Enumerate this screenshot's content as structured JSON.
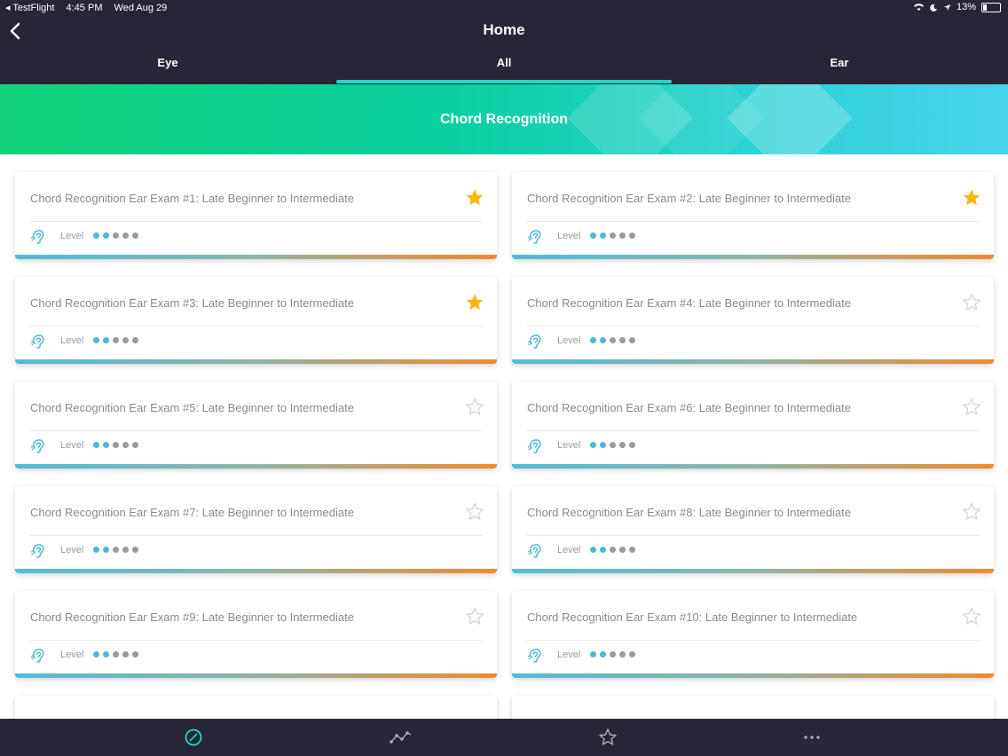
{
  "status_bar": {
    "carrier": "◂ TestFlight",
    "time": "4:45 PM",
    "date": "Wed Aug 29",
    "battery": "13%"
  },
  "header": {
    "title": "Home"
  },
  "tabs": [
    {
      "label": "Eye"
    },
    {
      "label": "All"
    },
    {
      "label": "Ear"
    }
  ],
  "banner": {
    "title": "Chord Recognition"
  },
  "cards": [
    {
      "title": "Chord Recognition Ear Exam #1: Late Beginner to Intermediate",
      "favorite": true,
      "level_label": "Level",
      "level": 2
    },
    {
      "title": "Chord Recognition Ear Exam #2: Late Beginner to Intermediate",
      "favorite": true,
      "level_label": "Level",
      "level": 2
    },
    {
      "title": "Chord Recognition Ear Exam #3: Late Beginner to Intermediate",
      "favorite": true,
      "level_label": "Level",
      "level": 2
    },
    {
      "title": "Chord Recognition Ear Exam #4: Late Beginner to Intermediate",
      "favorite": false,
      "level_label": "Level",
      "level": 2
    },
    {
      "title": "Chord Recognition Ear Exam #5: Late Beginner to Intermediate",
      "favorite": false,
      "level_label": "Level",
      "level": 2
    },
    {
      "title": "Chord Recognition Ear Exam #6: Late Beginner to Intermediate",
      "favorite": false,
      "level_label": "Level",
      "level": 2
    },
    {
      "title": "Chord Recognition Ear Exam #7: Late Beginner to Intermediate",
      "favorite": false,
      "level_label": "Level",
      "level": 2
    },
    {
      "title": "Chord Recognition Ear Exam #8: Late Beginner to Intermediate",
      "favorite": false,
      "level_label": "Level",
      "level": 2
    },
    {
      "title": "Chord Recognition Ear Exam #9: Late Beginner to Intermediate",
      "favorite": false,
      "level_label": "Level",
      "level": 2
    },
    {
      "title": "Chord Recognition Ear Exam #10: Late Beginner to Intermediate",
      "favorite": false,
      "level_label": "Level",
      "level": 2
    }
  ],
  "tab_bar": [
    {
      "icon": "compass-icon"
    },
    {
      "icon": "stats-icon"
    },
    {
      "icon": "star-icon"
    },
    {
      "icon": "more-icon"
    }
  ],
  "colors": {
    "accent": "#1fd8c2",
    "dark": "#272637",
    "star_gold": "#f5b80f",
    "dot_active": "#4cb9d2"
  }
}
